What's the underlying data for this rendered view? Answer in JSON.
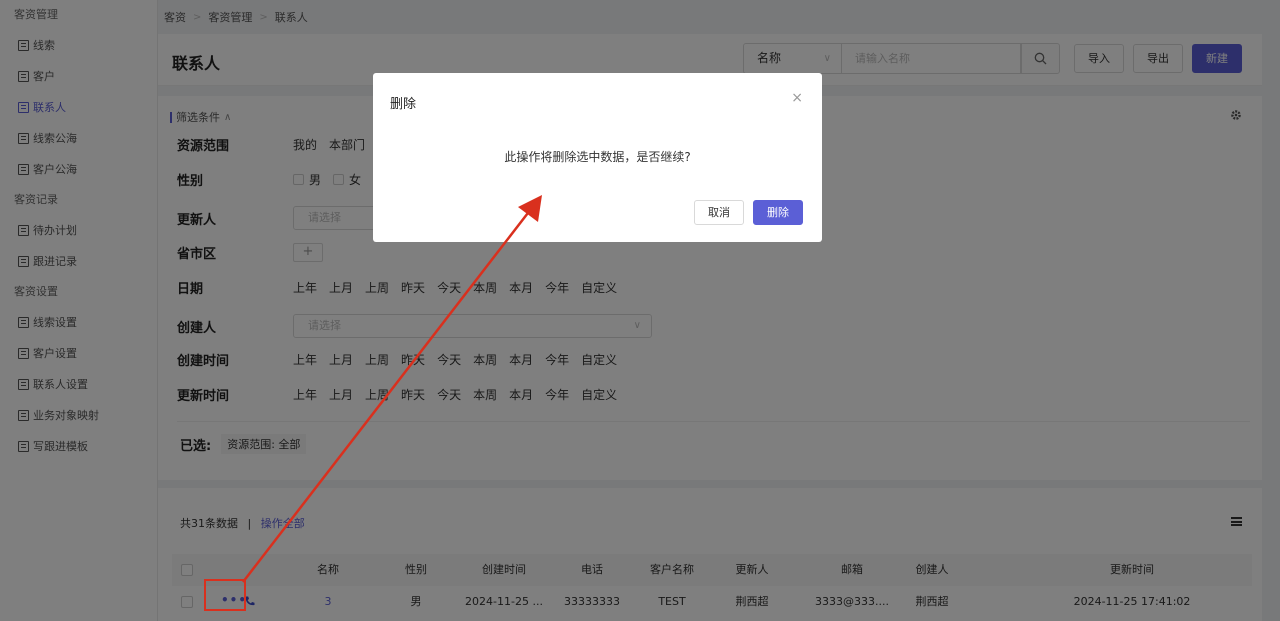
{
  "sidebar": {
    "group1": "客资管理",
    "items1": [
      {
        "label": "线索"
      },
      {
        "label": "客户"
      },
      {
        "label": "联系人"
      },
      {
        "label": "线索公海"
      },
      {
        "label": "客户公海"
      }
    ],
    "group2": "客资记录",
    "items2": [
      {
        "label": "待办计划"
      },
      {
        "label": "跟进记录"
      }
    ],
    "group3": "客资设置",
    "items3": [
      {
        "label": "线索设置"
      },
      {
        "label": "客户设置"
      },
      {
        "label": "联系人设置"
      },
      {
        "label": "业务对象映射"
      },
      {
        "label": "写跟进模板"
      }
    ]
  },
  "breadcrumb": [
    "客资",
    "客资管理",
    "联系人"
  ],
  "header": {
    "title": "联系人",
    "search_field": "名称",
    "search_placeholder": "请输入名称",
    "import_label": "导入",
    "export_label": "导出",
    "new_label": "新建"
  },
  "filter": {
    "title": "筛选条件",
    "rows": {
      "scope": {
        "label": "资源范围",
        "options": [
          "我的",
          "本部门"
        ]
      },
      "gender": {
        "label": "性别",
        "options": [
          "男",
          "女"
        ]
      },
      "updater": {
        "label": "更新人",
        "placeholder": "请选择"
      },
      "region": {
        "label": "省市区",
        "plus": "+"
      },
      "date": {
        "label": "日期"
      },
      "creator": {
        "label": "创建人",
        "placeholder": "请选择"
      },
      "create_time": {
        "label": "创建时间"
      },
      "update_time": {
        "label": "更新时间"
      }
    },
    "date_options": [
      "上年",
      "上月",
      "上周",
      "昨天",
      "今天",
      "本周",
      "本月",
      "今年",
      "自定义"
    ],
    "selected_label": "已选:",
    "selected_tag": "资源范围: 全部"
  },
  "table": {
    "count_text": "共31条数据",
    "separator": "|",
    "operate_all": "操作全部",
    "columns": [
      "名称",
      "性别",
      "创建时间",
      "电话",
      "客户名称",
      "更新人",
      "邮箱",
      "创建人",
      "更新时间"
    ],
    "rows": [
      {
        "more": "•••",
        "name": "3",
        "gender": "男",
        "created": "2024-11-25 ...",
        "phone": "33333333",
        "customer": "TEST",
        "updater": "荆西超",
        "email": "3333@333....",
        "creator": "荆西超",
        "updated": "2024-11-25 17:41:02"
      }
    ]
  },
  "dialog": {
    "title": "删除",
    "close": "×",
    "message": "此操作将删除选中数据，是否继续?",
    "cancel_label": "取消",
    "confirm_label": "删除"
  },
  "colors": {
    "accent": "#5b5fd6",
    "annotation": "#d9301e"
  }
}
